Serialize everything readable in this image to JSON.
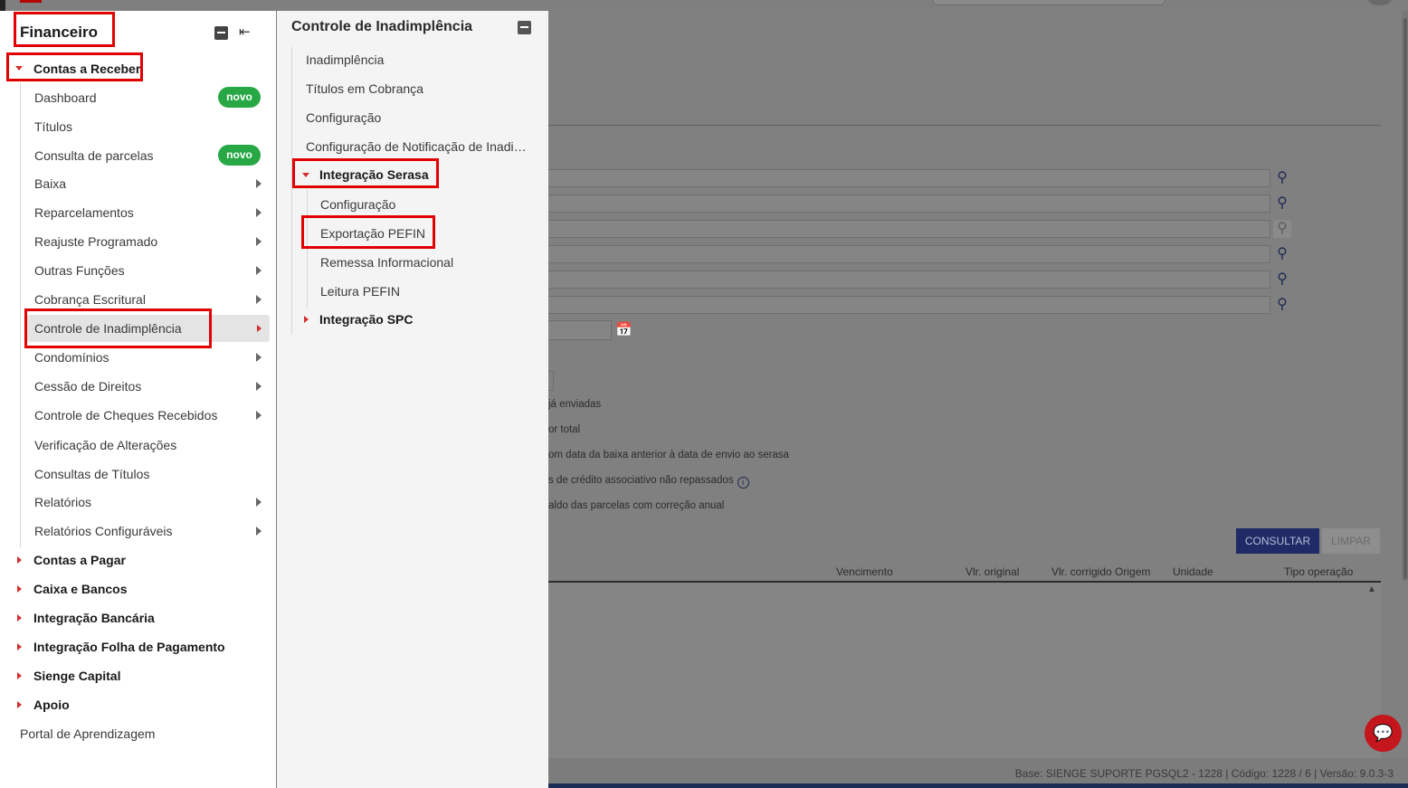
{
  "left_panel": {
    "title": "Financeiro",
    "contas_receber": {
      "label": "Contas a Receber",
      "items": [
        {
          "label": "Dashboard",
          "badge": "novo"
        },
        {
          "label": "Títulos"
        },
        {
          "label": "Consulta de parcelas",
          "badge": "novo"
        },
        {
          "label": "Baixa"
        },
        {
          "label": "Reparcelamentos"
        },
        {
          "label": "Reajuste Programado"
        },
        {
          "label": "Outras Funções"
        },
        {
          "label": "Cobrança Escritural"
        },
        {
          "label": "Controle de Inadimplência"
        },
        {
          "label": "Condomínios"
        },
        {
          "label": "Cessão de Direitos"
        },
        {
          "label": "Controle de Cheques Recebidos"
        },
        {
          "label": "Verificação de Alterações"
        },
        {
          "label": "Consultas de Títulos"
        },
        {
          "label": "Relatórios"
        },
        {
          "label": "Relatórios Configuráveis"
        }
      ]
    },
    "groups": [
      {
        "label": "Contas a Pagar"
      },
      {
        "label": "Caixa e Bancos"
      },
      {
        "label": "Integração Bancária"
      },
      {
        "label": "Integração Folha de Pagamento"
      },
      {
        "label": "Sienge Capital"
      },
      {
        "label": "Apoio"
      }
    ],
    "portal": "Portal de Aprendizagem"
  },
  "right_panel": {
    "title": "Controle de Inadimplência",
    "items": [
      {
        "label": "Inadimplência"
      },
      {
        "label": "Títulos em Cobrança"
      },
      {
        "label": "Configuração"
      },
      {
        "label": "Configuração de Notificação de Inadi…"
      }
    ],
    "serasa": {
      "label": "Integração Serasa",
      "items": [
        {
          "label": "Configuração"
        },
        {
          "label": "Exportação PEFIN"
        },
        {
          "label": "Remessa Informacional"
        },
        {
          "label": "Leitura PEFIN"
        }
      ]
    },
    "spc": {
      "label": "Integração SPC"
    }
  },
  "background": {
    "options": [
      "já enviadas",
      "or total",
      "om data da baixa anterior à data de envio ao serasa",
      "s de crédito associativo não repassados",
      "aldo das parcelas com correção anual"
    ],
    "buttons": {
      "consultar": "CONSULTAR",
      "limpar": "LIMPAR"
    },
    "columns": [
      "Vencimento",
      "Vlr. original",
      "Vlr. corrigido Origem",
      "Unidade",
      "Tipo operação"
    ],
    "footer": "Base: SIENGE SUPORTE PGSQL2 - 1228 | Código: 1228 / 6 | Versão: 9.0.3-3"
  },
  "icons": {
    "lookup": "search-icon",
    "calendar": "calendar-icon",
    "chat": "chat-icon"
  },
  "colors": {
    "highlight": "#e00000",
    "caret": "#d32f2f",
    "badge": "#27a844",
    "primary_button": "#1f2a66",
    "chat": "#c4161c"
  }
}
